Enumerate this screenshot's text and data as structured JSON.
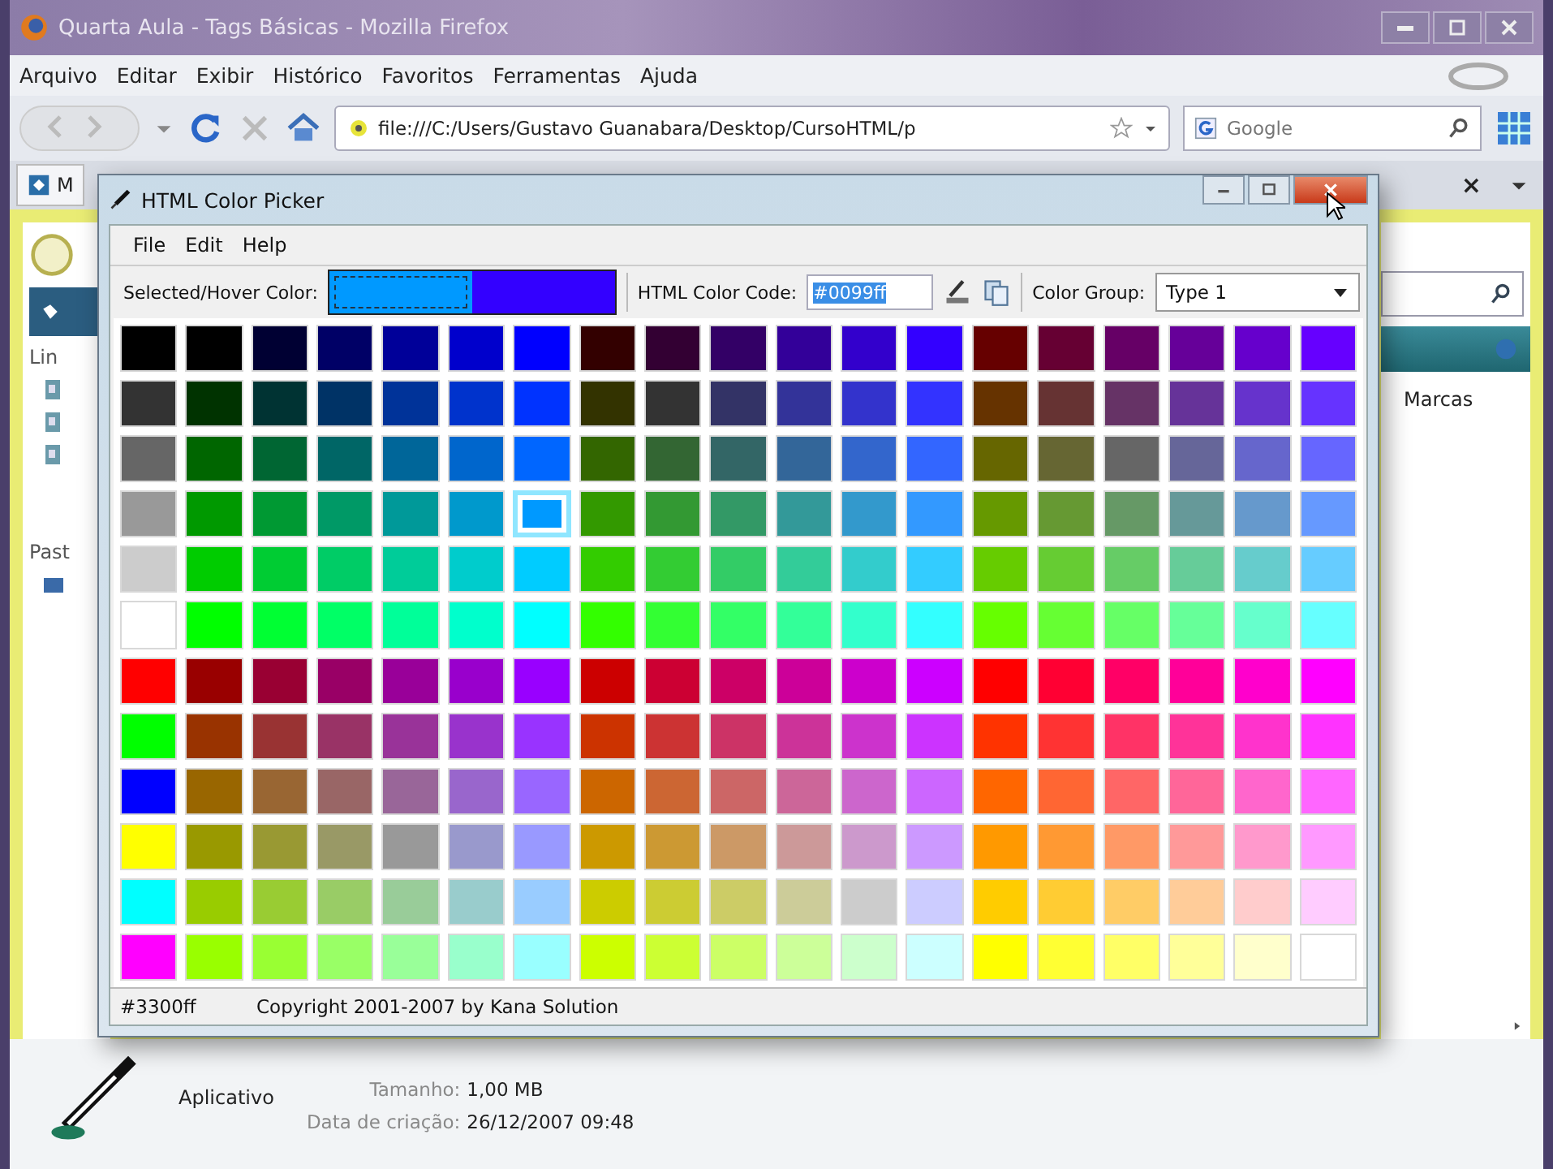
{
  "browser": {
    "title": "Quarta Aula - Tags Básicas - Mozilla Firefox",
    "menu": [
      "Arquivo",
      "Editar",
      "Exibir",
      "Histórico",
      "Favoritos",
      "Ferramentas",
      "Ajuda"
    ],
    "address": "file:///C:/Users/Gustavo Guanabara/Desktop/CursoHTML/p",
    "search": {
      "placeholder": "Google"
    },
    "tab": {
      "label": "M",
      "close": "×"
    }
  },
  "background_panel": {
    "left_items": [
      "Lin",
      "Past"
    ],
    "column_header": "Marcas",
    "details": {
      "type": "Aplicativo",
      "size_label": "Tamanho:",
      "size": "1,00 MB",
      "date_label": "Data de criação:",
      "date": "26/12/2007 09:48"
    }
  },
  "picker": {
    "title": "HTML Color Picker",
    "menu": [
      "File",
      "Edit",
      "Help"
    ],
    "preview_label": "Selected/Hover Color:",
    "preview_swatches": [
      {
        "color": "#0099ff"
      },
      {
        "color": "#3300ff"
      }
    ],
    "code_label": "HTML Color Code:",
    "code": "#0099ff",
    "group_label": "Color Group:",
    "group": "Type 1",
    "status_code": "#3300ff",
    "copyright": "Copyright 2001-2007 by Kana Solution",
    "rows": [
      {
        "swatches": [
          {
            "color": "#000000",
            "selected": false
          },
          {
            "color": "#000000",
            "selected": false
          },
          {
            "color": "#000033",
            "selected": false
          },
          {
            "color": "#000066",
            "selected": false
          },
          {
            "color": "#000099",
            "selected": false
          },
          {
            "color": "#0000cc",
            "selected": false
          },
          {
            "color": "#0000ff",
            "selected": false
          },
          {
            "color": "#330000",
            "selected": false
          },
          {
            "color": "#330033",
            "selected": false
          },
          {
            "color": "#330066",
            "selected": false
          },
          {
            "color": "#330099",
            "selected": false
          },
          {
            "color": "#3300cc",
            "selected": false
          },
          {
            "color": "#3300ff",
            "selected": false
          },
          {
            "color": "#660000",
            "selected": false
          },
          {
            "color": "#660033",
            "selected": false
          },
          {
            "color": "#660066",
            "selected": false
          },
          {
            "color": "#660099",
            "selected": false
          },
          {
            "color": "#6600cc",
            "selected": false
          },
          {
            "color": "#6600ff",
            "selected": false
          }
        ]
      },
      {
        "swatches": [
          {
            "color": "#333333",
            "selected": false
          },
          {
            "color": "#003300",
            "selected": false
          },
          {
            "color": "#003333",
            "selected": false
          },
          {
            "color": "#003366",
            "selected": false
          },
          {
            "color": "#003399",
            "selected": false
          },
          {
            "color": "#0033cc",
            "selected": false
          },
          {
            "color": "#0033ff",
            "selected": false
          },
          {
            "color": "#333300",
            "selected": false
          },
          {
            "color": "#333333",
            "selected": false
          },
          {
            "color": "#333366",
            "selected": false
          },
          {
            "color": "#333399",
            "selected": false
          },
          {
            "color": "#3333cc",
            "selected": false
          },
          {
            "color": "#3333ff",
            "selected": false
          },
          {
            "color": "#663300",
            "selected": false
          },
          {
            "color": "#663333",
            "selected": false
          },
          {
            "color": "#663366",
            "selected": false
          },
          {
            "color": "#663399",
            "selected": false
          },
          {
            "color": "#6633cc",
            "selected": false
          },
          {
            "color": "#6633ff",
            "selected": false
          }
        ]
      },
      {
        "swatches": [
          {
            "color": "#666666",
            "selected": false
          },
          {
            "color": "#006600",
            "selected": false
          },
          {
            "color": "#006633",
            "selected": false
          },
          {
            "color": "#006666",
            "selected": false
          },
          {
            "color": "#006699",
            "selected": false
          },
          {
            "color": "#0066cc",
            "selected": false
          },
          {
            "color": "#0066ff",
            "selected": false
          },
          {
            "color": "#336600",
            "selected": false
          },
          {
            "color": "#336633",
            "selected": false
          },
          {
            "color": "#336666",
            "selected": false
          },
          {
            "color": "#336699",
            "selected": false
          },
          {
            "color": "#3366cc",
            "selected": false
          },
          {
            "color": "#3366ff",
            "selected": false
          },
          {
            "color": "#666600",
            "selected": false
          },
          {
            "color": "#666633",
            "selected": false
          },
          {
            "color": "#666666",
            "selected": false
          },
          {
            "color": "#666699",
            "selected": false
          },
          {
            "color": "#6666cc",
            "selected": false
          },
          {
            "color": "#6666ff",
            "selected": false
          }
        ]
      },
      {
        "swatches": [
          {
            "color": "#999999",
            "selected": false
          },
          {
            "color": "#009900",
            "selected": false
          },
          {
            "color": "#009933",
            "selected": false
          },
          {
            "color": "#009966",
            "selected": false
          },
          {
            "color": "#009999",
            "selected": false
          },
          {
            "color": "#0099cc",
            "selected": false
          },
          {
            "color": "#0099ff",
            "selected": true
          },
          {
            "color": "#339900",
            "selected": false
          },
          {
            "color": "#339933",
            "selected": false
          },
          {
            "color": "#339966",
            "selected": false
          },
          {
            "color": "#339999",
            "selected": false
          },
          {
            "color": "#3399cc",
            "selected": false
          },
          {
            "color": "#3399ff",
            "selected": false
          },
          {
            "color": "#669900",
            "selected": false
          },
          {
            "color": "#669933",
            "selected": false
          },
          {
            "color": "#669966",
            "selected": false
          },
          {
            "color": "#669999",
            "selected": false
          },
          {
            "color": "#6699cc",
            "selected": false
          },
          {
            "color": "#6699ff",
            "selected": false
          }
        ]
      },
      {
        "swatches": [
          {
            "color": "#cccccc",
            "selected": false
          },
          {
            "color": "#00cc00",
            "selected": false
          },
          {
            "color": "#00cc33",
            "selected": false
          },
          {
            "color": "#00cc66",
            "selected": false
          },
          {
            "color": "#00cc99",
            "selected": false
          },
          {
            "color": "#00cccc",
            "selected": false
          },
          {
            "color": "#00ccff",
            "selected": false
          },
          {
            "color": "#33cc00",
            "selected": false
          },
          {
            "color": "#33cc33",
            "selected": false
          },
          {
            "color": "#33cc66",
            "selected": false
          },
          {
            "color": "#33cc99",
            "selected": false
          },
          {
            "color": "#33cccc",
            "selected": false
          },
          {
            "color": "#33ccff",
            "selected": false
          },
          {
            "color": "#66cc00",
            "selected": false
          },
          {
            "color": "#66cc33",
            "selected": false
          },
          {
            "color": "#66cc66",
            "selected": false
          },
          {
            "color": "#66cc99",
            "selected": false
          },
          {
            "color": "#66cccc",
            "selected": false
          },
          {
            "color": "#66ccff",
            "selected": false
          }
        ]
      },
      {
        "swatches": [
          {
            "color": "#ffffff",
            "selected": false
          },
          {
            "color": "#00ff00",
            "selected": false
          },
          {
            "color": "#00ff33",
            "selected": false
          },
          {
            "color": "#00ff66",
            "selected": false
          },
          {
            "color": "#00ff99",
            "selected": false
          },
          {
            "color": "#00ffcc",
            "selected": false
          },
          {
            "color": "#00ffff",
            "selected": false
          },
          {
            "color": "#33ff00",
            "selected": false
          },
          {
            "color": "#33ff33",
            "selected": false
          },
          {
            "color": "#33ff66",
            "selected": false
          },
          {
            "color": "#33ff99",
            "selected": false
          },
          {
            "color": "#33ffcc",
            "selected": false
          },
          {
            "color": "#33ffff",
            "selected": false
          },
          {
            "color": "#66ff00",
            "selected": false
          },
          {
            "color": "#66ff33",
            "selected": false
          },
          {
            "color": "#66ff66",
            "selected": false
          },
          {
            "color": "#66ff99",
            "selected": false
          },
          {
            "color": "#66ffcc",
            "selected": false
          },
          {
            "color": "#66ffff",
            "selected": false
          }
        ]
      },
      {
        "swatches": [
          {
            "color": "#ff0000",
            "selected": false
          },
          {
            "color": "#990000",
            "selected": false
          },
          {
            "color": "#990033",
            "selected": false
          },
          {
            "color": "#990066",
            "selected": false
          },
          {
            "color": "#990099",
            "selected": false
          },
          {
            "color": "#9900cc",
            "selected": false
          },
          {
            "color": "#9900ff",
            "selected": false
          },
          {
            "color": "#cc0000",
            "selected": false
          },
          {
            "color": "#cc0033",
            "selected": false
          },
          {
            "color": "#cc0066",
            "selected": false
          },
          {
            "color": "#cc0099",
            "selected": false
          },
          {
            "color": "#cc00cc",
            "selected": false
          },
          {
            "color": "#cc00ff",
            "selected": false
          },
          {
            "color": "#ff0000",
            "selected": false
          },
          {
            "color": "#ff0033",
            "selected": false
          },
          {
            "color": "#ff0066",
            "selected": false
          },
          {
            "color": "#ff0099",
            "selected": false
          },
          {
            "color": "#ff00cc",
            "selected": false
          },
          {
            "color": "#ff00ff",
            "selected": false
          }
        ]
      },
      {
        "swatches": [
          {
            "color": "#00ff00",
            "selected": false
          },
          {
            "color": "#993300",
            "selected": false
          },
          {
            "color": "#993333",
            "selected": false
          },
          {
            "color": "#993366",
            "selected": false
          },
          {
            "color": "#993399",
            "selected": false
          },
          {
            "color": "#9933cc",
            "selected": false
          },
          {
            "color": "#9933ff",
            "selected": false
          },
          {
            "color": "#cc3300",
            "selected": false
          },
          {
            "color": "#cc3333",
            "selected": false
          },
          {
            "color": "#cc3366",
            "selected": false
          },
          {
            "color": "#cc3399",
            "selected": false
          },
          {
            "color": "#cc33cc",
            "selected": false
          },
          {
            "color": "#cc33ff",
            "selected": false
          },
          {
            "color": "#ff3300",
            "selected": false
          },
          {
            "color": "#ff3333",
            "selected": false
          },
          {
            "color": "#ff3366",
            "selected": false
          },
          {
            "color": "#ff3399",
            "selected": false
          },
          {
            "color": "#ff33cc",
            "selected": false
          },
          {
            "color": "#ff33ff",
            "selected": false
          }
        ]
      },
      {
        "swatches": [
          {
            "color": "#0000ff",
            "selected": false
          },
          {
            "color": "#996600",
            "selected": false
          },
          {
            "color": "#996633",
            "selected": false
          },
          {
            "color": "#996666",
            "selected": false
          },
          {
            "color": "#996699",
            "selected": false
          },
          {
            "color": "#9966cc",
            "selected": false
          },
          {
            "color": "#9966ff",
            "selected": false
          },
          {
            "color": "#cc6600",
            "selected": false
          },
          {
            "color": "#cc6633",
            "selected": false
          },
          {
            "color": "#cc6666",
            "selected": false
          },
          {
            "color": "#cc6699",
            "selected": false
          },
          {
            "color": "#cc66cc",
            "selected": false
          },
          {
            "color": "#cc66ff",
            "selected": false
          },
          {
            "color": "#ff6600",
            "selected": false
          },
          {
            "color": "#ff6633",
            "selected": false
          },
          {
            "color": "#ff6666",
            "selected": false
          },
          {
            "color": "#ff6699",
            "selected": false
          },
          {
            "color": "#ff66cc",
            "selected": false
          },
          {
            "color": "#ff66ff",
            "selected": false
          }
        ]
      },
      {
        "swatches": [
          {
            "color": "#ffff00",
            "selected": false
          },
          {
            "color": "#999900",
            "selected": false
          },
          {
            "color": "#999933",
            "selected": false
          },
          {
            "color": "#999966",
            "selected": false
          },
          {
            "color": "#999999",
            "selected": false
          },
          {
            "color": "#9999cc",
            "selected": false
          },
          {
            "color": "#9999ff",
            "selected": false
          },
          {
            "color": "#cc9900",
            "selected": false
          },
          {
            "color": "#cc9933",
            "selected": false
          },
          {
            "color": "#cc9966",
            "selected": false
          },
          {
            "color": "#cc9999",
            "selected": false
          },
          {
            "color": "#cc99cc",
            "selected": false
          },
          {
            "color": "#cc99ff",
            "selected": false
          },
          {
            "color": "#ff9900",
            "selected": false
          },
          {
            "color": "#ff9933",
            "selected": false
          },
          {
            "color": "#ff9966",
            "selected": false
          },
          {
            "color": "#ff9999",
            "selected": false
          },
          {
            "color": "#ff99cc",
            "selected": false
          },
          {
            "color": "#ff99ff",
            "selected": false
          }
        ]
      },
      {
        "swatches": [
          {
            "color": "#00ffff",
            "selected": false
          },
          {
            "color": "#99cc00",
            "selected": false
          },
          {
            "color": "#99cc33",
            "selected": false
          },
          {
            "color": "#99cc66",
            "selected": false
          },
          {
            "color": "#99cc99",
            "selected": false
          },
          {
            "color": "#99cccc",
            "selected": false
          },
          {
            "color": "#99ccff",
            "selected": false
          },
          {
            "color": "#cccc00",
            "selected": false
          },
          {
            "color": "#cccc33",
            "selected": false
          },
          {
            "color": "#cccc66",
            "selected": false
          },
          {
            "color": "#cccc99",
            "selected": false
          },
          {
            "color": "#cccccc",
            "selected": false
          },
          {
            "color": "#ccccff",
            "selected": false
          },
          {
            "color": "#ffcc00",
            "selected": false
          },
          {
            "color": "#ffcc33",
            "selected": false
          },
          {
            "color": "#ffcc66",
            "selected": false
          },
          {
            "color": "#ffcc99",
            "selected": false
          },
          {
            "color": "#ffcccc",
            "selected": false
          },
          {
            "color": "#ffccff",
            "selected": false
          }
        ]
      },
      {
        "swatches": [
          {
            "color": "#ff00ff",
            "selected": false
          },
          {
            "color": "#99ff00",
            "selected": false
          },
          {
            "color": "#99ff33",
            "selected": false
          },
          {
            "color": "#99ff66",
            "selected": false
          },
          {
            "color": "#99ff99",
            "selected": false
          },
          {
            "color": "#99ffcc",
            "selected": false
          },
          {
            "color": "#99ffff",
            "selected": false
          },
          {
            "color": "#ccff00",
            "selected": false
          },
          {
            "color": "#ccff33",
            "selected": false
          },
          {
            "color": "#ccff66",
            "selected": false
          },
          {
            "color": "#ccff99",
            "selected": false
          },
          {
            "color": "#ccffcc",
            "selected": false
          },
          {
            "color": "#ccffff",
            "selected": false
          },
          {
            "color": "#ffff00",
            "selected": false
          },
          {
            "color": "#ffff33",
            "selected": false
          },
          {
            "color": "#ffff66",
            "selected": false
          },
          {
            "color": "#ffff99",
            "selected": false
          },
          {
            "color": "#ffffcc",
            "selected": false
          },
          {
            "color": "#ffffff",
            "selected": false
          }
        ]
      }
    ]
  }
}
